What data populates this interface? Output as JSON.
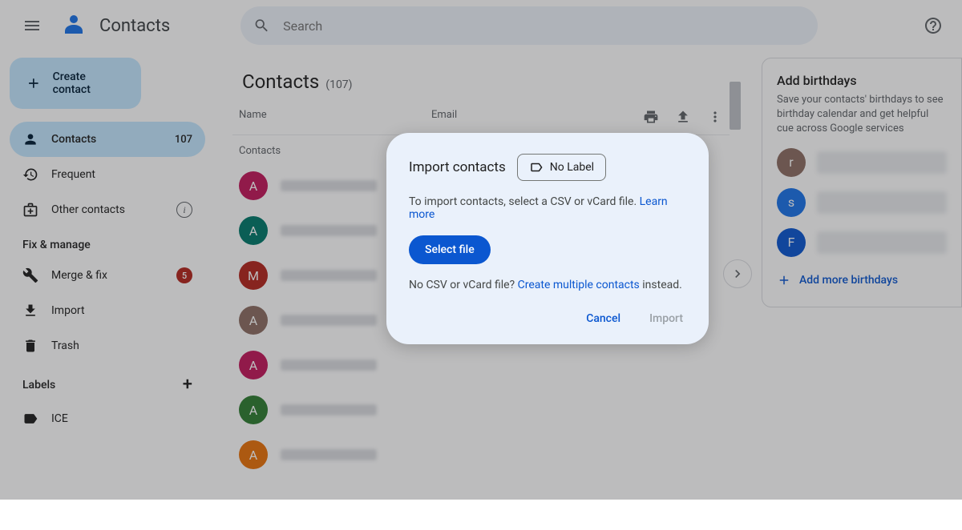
{
  "header": {
    "app_title": "Contacts",
    "search_placeholder": "Search"
  },
  "sidebar": {
    "create_label": "Create contact",
    "items": [
      {
        "icon": "person",
        "label": "Contacts",
        "count": "107",
        "active": true
      },
      {
        "icon": "history",
        "label": "Frequent"
      },
      {
        "icon": "archive",
        "label": "Other contacts",
        "info": true
      }
    ],
    "fix_section": "Fix & manage",
    "fix_items": [
      {
        "icon": "tools",
        "label": "Merge & fix",
        "badge": "5"
      },
      {
        "icon": "download",
        "label": "Import"
      },
      {
        "icon": "trash",
        "label": "Trash"
      }
    ],
    "labels_section": "Labels",
    "label_items": [
      {
        "icon": "label",
        "label": "ICE"
      }
    ]
  },
  "main": {
    "title": "Contacts",
    "count": "(107)",
    "col_name": "Name",
    "col_email": "Email",
    "subhead": "Contacts",
    "contacts": [
      {
        "letter": "A",
        "color": "#c2185b"
      },
      {
        "letter": "A",
        "color": "#00796b"
      },
      {
        "letter": "M",
        "color": "#b3261e"
      },
      {
        "letter": "A",
        "color": "#8d6e63"
      },
      {
        "letter": "A",
        "color": "#c2185b"
      },
      {
        "letter": "A",
        "color": "#2e7d32"
      },
      {
        "letter": "A",
        "color": "#e8710a"
      }
    ]
  },
  "side_card": {
    "title": "Add birthdays",
    "text": "Save your contacts' birthdays to see birthday calendar and get helpful cue across Google services",
    "items": [
      {
        "letter": "r",
        "color": "#8d6e63"
      },
      {
        "letter": "s",
        "color": "#1a73e8"
      },
      {
        "letter": "F",
        "color": "#0b57d0"
      }
    ],
    "add_label": "Add more birthdays"
  },
  "modal": {
    "title": "Import contacts",
    "label_chip": "No Label",
    "text1": "To import contacts, select a CSV or vCard file. ",
    "learn_more": "Learn more",
    "select_file": "Select file",
    "text2a": "No CSV or vCard file? ",
    "text2_link": "Create multiple contacts",
    "text2b": " instead.",
    "cancel": "Cancel",
    "import": "Import"
  }
}
